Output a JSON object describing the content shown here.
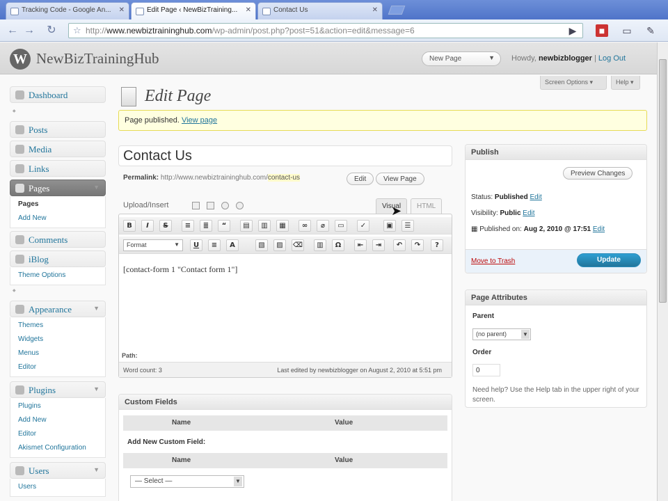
{
  "browser": {
    "tabs": [
      {
        "title": "Tracking Code - Google An..."
      },
      {
        "title": "Edit Page ‹ NewBizTraining..."
      },
      {
        "title": "Contact Us"
      }
    ],
    "url_prefix": "http://",
    "url_host": "www.newbiztraininghub.com",
    "url_path": "/wp-admin/post.php?post=51&action=edit&message=6"
  },
  "header": {
    "logo": "W",
    "site_name": "NewBizTrainingHub",
    "favorites_label": "New Page",
    "howdy_label": "Howdy,",
    "username": "newbizblogger",
    "separator": "|",
    "logout_label": "Log Out",
    "screen_options_label": "Screen Options ▾",
    "help_label": "Help ▾"
  },
  "sidebar": {
    "dashboard": "Dashboard",
    "posts": "Posts",
    "media": "Media",
    "links": "Links",
    "pages": "Pages",
    "pages_sub": [
      "Pages",
      "Add New"
    ],
    "comments": "Comments",
    "iblog": "iBlog",
    "iblog_sub": [
      "Theme Options"
    ],
    "appearance": "Appearance",
    "appearance_sub": [
      "Themes",
      "Widgets",
      "Menus",
      "Editor"
    ],
    "plugins": "Plugins",
    "plugins_sub": [
      "Plugins",
      "Add New",
      "Editor",
      "Akismet Configuration"
    ],
    "users": "Users",
    "users_sub": [
      "Users"
    ]
  },
  "main": {
    "title": "Edit Page",
    "notice_text": "Page published.",
    "notice_link": "View page",
    "post_title": "Contact Us",
    "permalink_label": "Permalink:",
    "permalink_base": "http://www.newbiztraininghub.com/",
    "permalink_slug": "contact-us",
    "edit_btn": "Edit",
    "view_page_btn": "View Page",
    "upload_insert": "Upload/Insert",
    "tab_visual": "Visual",
    "tab_html": "HTML",
    "format_select": "Format",
    "content": "[contact-form 1 \"Contact form 1\"]",
    "path_label": "Path:",
    "word_count": "Word count: 3",
    "last_edited": "Last edited by newbizblogger on August 2, 2010 at 5:51 pm"
  },
  "custom_fields": {
    "title": "Custom Fields",
    "col_name": "Name",
    "col_value": "Value",
    "add_new_label": "Add New Custom Field:",
    "select_value": "— Select —"
  },
  "publish": {
    "title": "Publish",
    "preview_btn": "Preview Changes",
    "status_label": "Status:",
    "status_value": "Published",
    "visibility_label": "Visibility:",
    "visibility_value": "Public",
    "published_label": "Published on:",
    "published_value": "Aug 2, 2010 @ 17:51",
    "edit_link": "Edit",
    "trash_label": "Move to Trash",
    "update_btn": "Update"
  },
  "page_attributes": {
    "title": "Page Attributes",
    "parent_label": "Parent",
    "parent_value": "(no parent)",
    "order_label": "Order",
    "order_value": "0",
    "help_text": "Need help? Use the Help tab in the upper right of your screen."
  },
  "colors": {
    "link": "#21759b",
    "notice_bg": "#ffffe0",
    "update_button": "#21759b"
  }
}
